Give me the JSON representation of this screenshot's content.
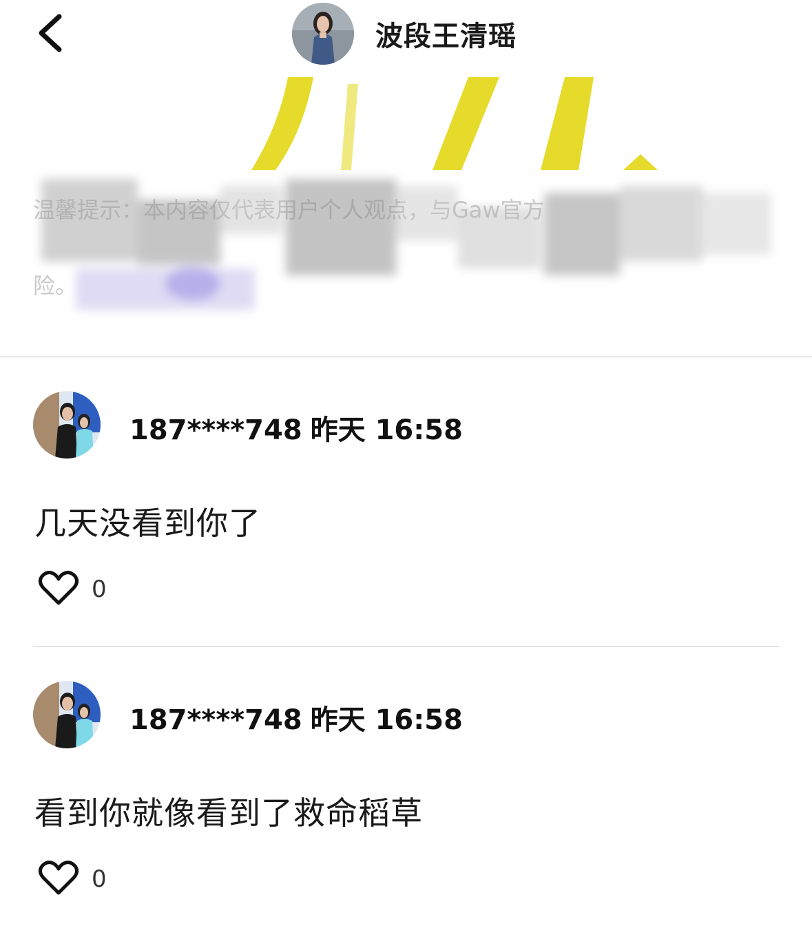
{
  "header": {
    "title": "波段王清瑶",
    "back_icon": "chevron-left-icon"
  },
  "notice": {
    "line1": "温馨提示：本内容仅代表用户个人观点，与Gaw官方",
    "line2": "险。"
  },
  "comments": [
    {
      "user": "187****748",
      "time": "昨天 16:58",
      "text": "几天没看到你了",
      "likes": "0"
    },
    {
      "user": "187****748",
      "time": "昨天 16:58",
      "text": "看到你就像看到了救命稻草",
      "likes": "0"
    }
  ],
  "colors": {
    "accent_yellow": "#e6db2a",
    "text": "#111111",
    "divider": "#e4e4e4"
  }
}
